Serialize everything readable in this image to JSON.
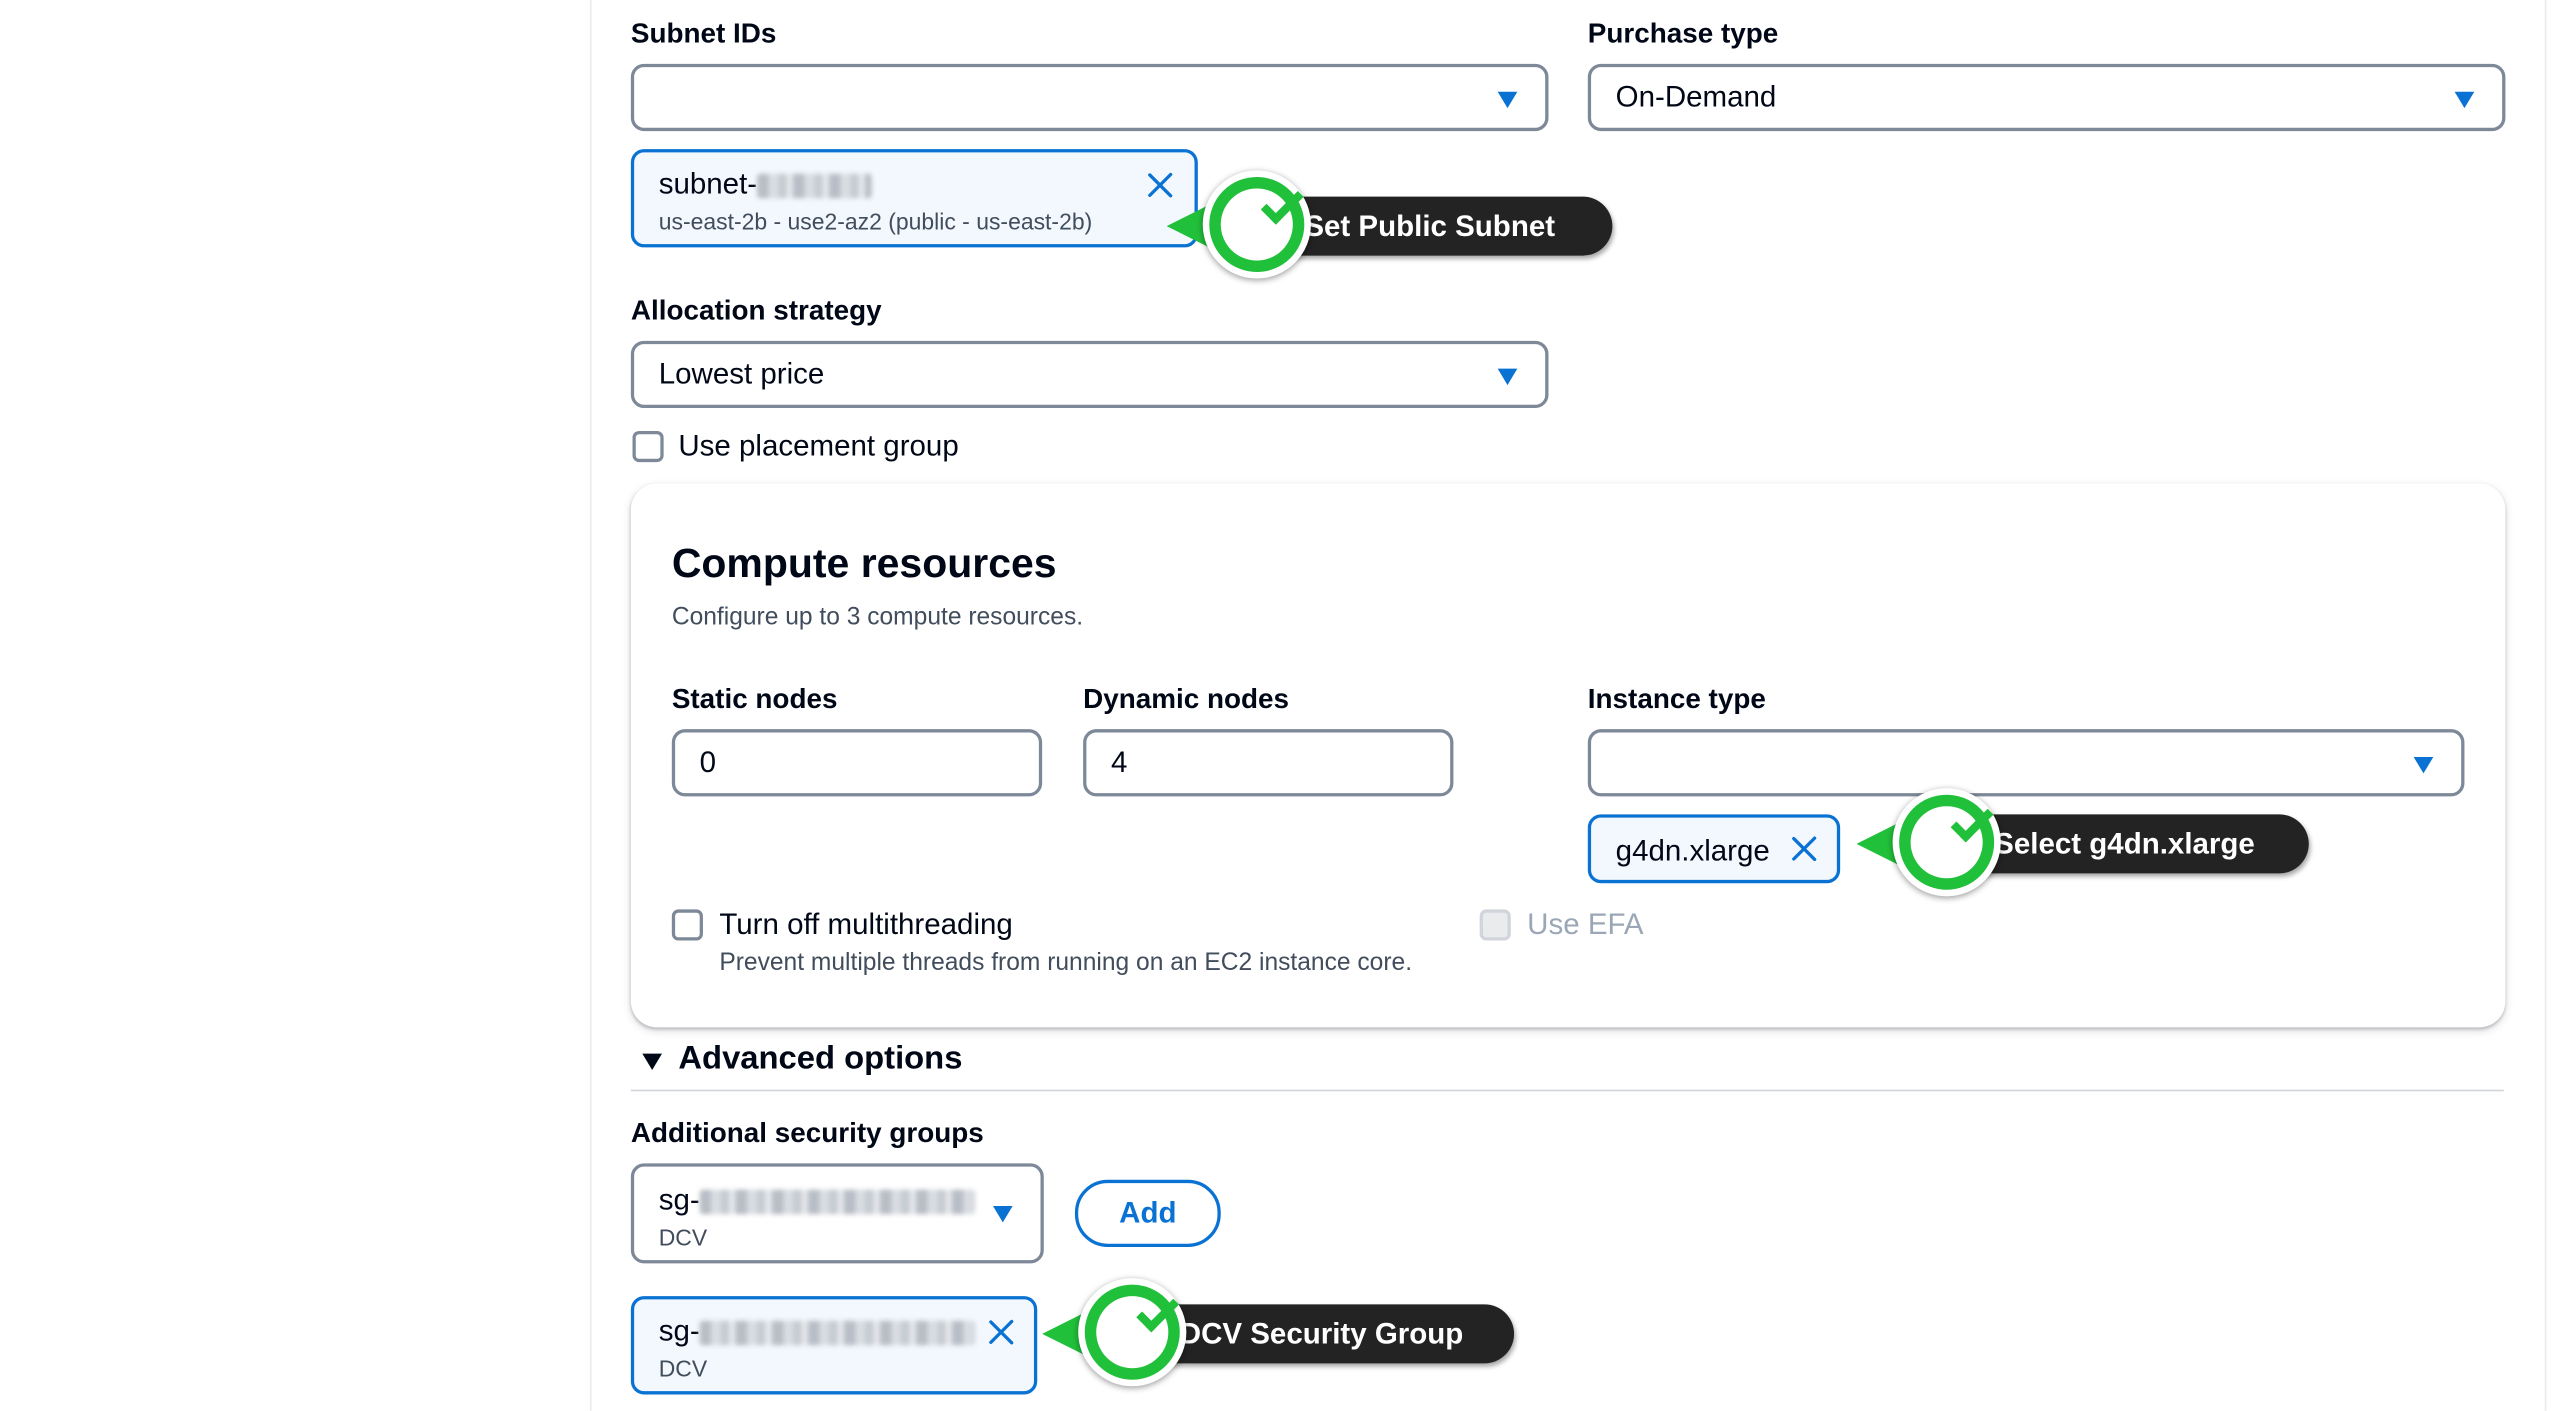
{
  "subnet": {
    "label": "Subnet IDs",
    "select_value": "",
    "token": {
      "prefix": "subnet-",
      "detail": "us-east-2b - use2-az2 (public - us-east-2b)"
    }
  },
  "purchase": {
    "label": "Purchase type",
    "value": "On-Demand"
  },
  "allocation": {
    "label": "Allocation strategy",
    "value": "Lowest price"
  },
  "placement": {
    "label": "Use placement group",
    "checked": false
  },
  "compute": {
    "title": "Compute resources",
    "description": "Configure up to 3 compute resources.",
    "static_label": "Static nodes",
    "static_value": "0",
    "dynamic_label": "Dynamic nodes",
    "dynamic_value": "4",
    "instance_label": "Instance type",
    "instance_select_value": "",
    "instance_token": "g4dn.xlarge",
    "multithreading_label": "Turn off multithreading",
    "multithreading_desc": "Prevent multiple threads from running on an EC2 instance core.",
    "efa_label": "Use EFA"
  },
  "advanced": {
    "label": "Advanced options",
    "sg_label": "Additional security groups",
    "sg_select_prefix": "sg-",
    "sg_select_desc": "DCV",
    "add_button": "Add",
    "sg_token_prefix": "sg-",
    "sg_token_desc": "DCV"
  },
  "callouts": {
    "subnet": "Set Public Subnet",
    "instance": "Select g4dn.xlarge",
    "security": "DCV Security Group"
  },
  "colors": {
    "accent": "#0972d3",
    "callout_green": "#21c03a",
    "callout_dark": "#232323"
  }
}
